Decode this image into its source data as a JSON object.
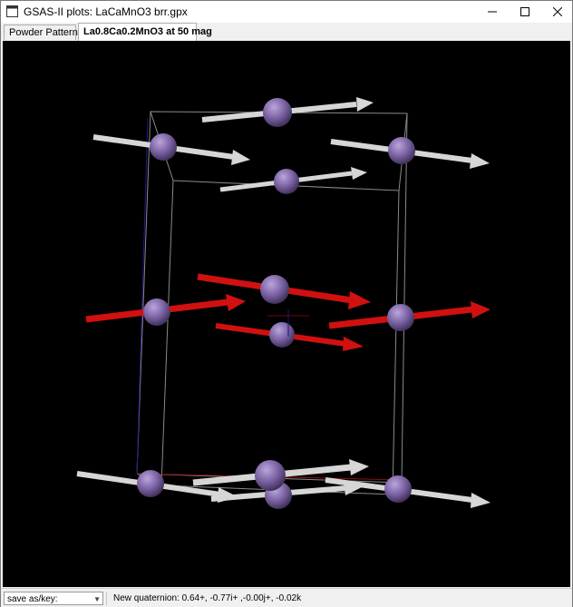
{
  "window": {
    "title": "GSAS-II plots: LaCaMnO3 brr.gpx",
    "app_icon": "gsas-window-icon",
    "controls": [
      "minimize",
      "maximize",
      "close"
    ]
  },
  "tabs": [
    {
      "label": "Powder Patterns",
      "active": false
    },
    {
      "label": "La0.8Ca0.2MnO3 at 50 mag",
      "active": true
    }
  ],
  "plot": {
    "kind": "3D magnetic structure view",
    "background_color": "#000000",
    "atom_color": "#7b62a3",
    "moment_colors": {
      "gray": "#d6d6d6",
      "red": "#d11010"
    },
    "cell_edge_color": "#8a8a8a"
  },
  "status": {
    "save_combo_value": "save as/key:",
    "message": "New quaternion: 0.64+, -0.77i+ ,-0.00j+, -0.02k"
  }
}
